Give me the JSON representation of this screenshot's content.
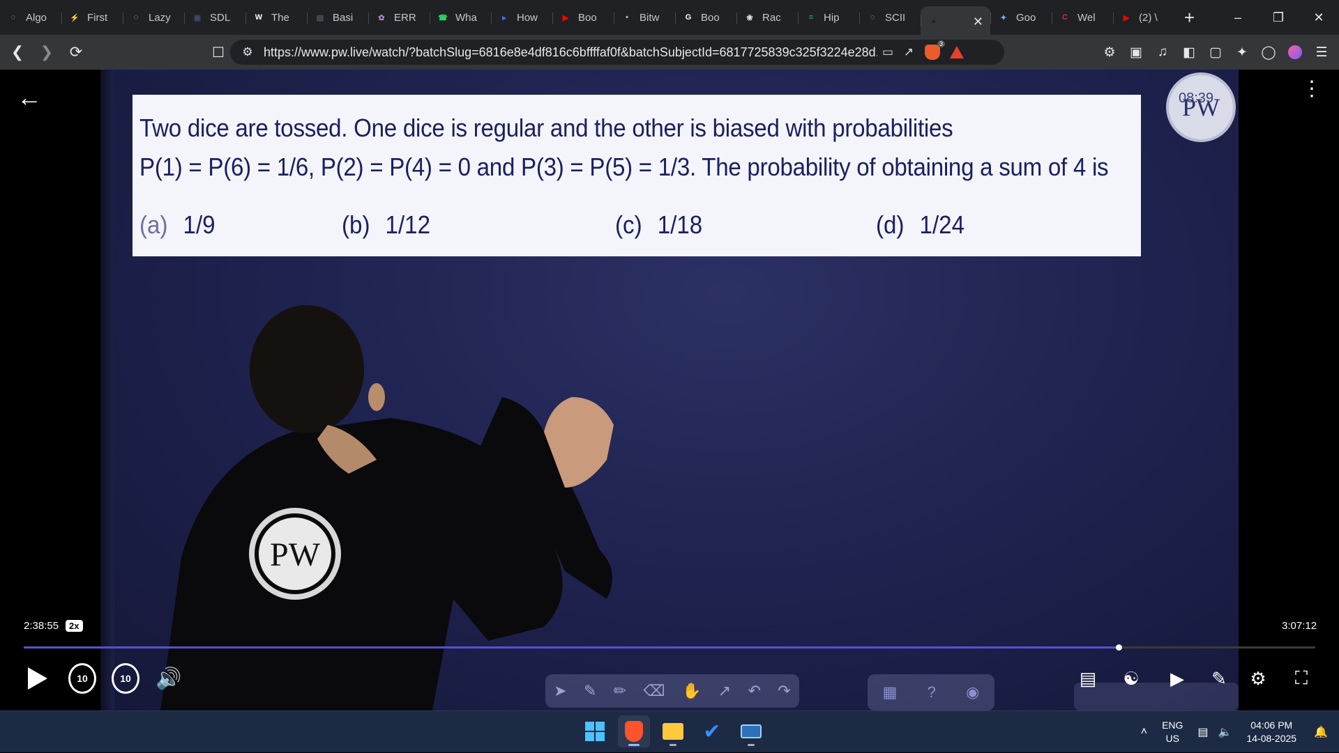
{
  "browser": {
    "tabs": [
      {
        "label": "Algo",
        "icon": "globe-icon",
        "color": "#8fb3c9"
      },
      {
        "label": "First",
        "icon": "bolt-icon",
        "color": "#f0b429"
      },
      {
        "label": "Lazy",
        "icon": "globe-icon",
        "color": "#bdbdbd"
      },
      {
        "label": "SDL",
        "icon": "dark-site-icon",
        "color": "#3b4a6b"
      },
      {
        "label": "The",
        "icon": "w3schools-icon",
        "color": "#ffffff"
      },
      {
        "label": "Basi",
        "icon": "grey-site-icon",
        "color": "#555"
      },
      {
        "label": "ERR",
        "icon": "brain-icon",
        "color": "#a98ad0"
      },
      {
        "label": "Wha",
        "icon": "whatsapp-icon",
        "color": "#25d366"
      },
      {
        "label": "How",
        "icon": "bookmark-icon",
        "color": "#4a6fe3"
      },
      {
        "label": "Boo",
        "icon": "youtube-icon",
        "color": "#ff0000"
      },
      {
        "label": "Bitw",
        "icon": "bitwise-icon",
        "color": "#bdbdbd"
      },
      {
        "label": "Boo",
        "icon": "google-icon",
        "color": "#ffffff"
      },
      {
        "label": "Rac",
        "icon": "openai-icon",
        "color": "#e6e6e6"
      },
      {
        "label": "Hip",
        "icon": "spotify-icon",
        "color": "#1db954"
      },
      {
        "label": "SCII",
        "icon": "globe-icon",
        "color": "#bdbdbd"
      },
      {
        "label": "",
        "icon": "pw-tab-icon",
        "color": "#222"
      },
      {
        "label": "Goo",
        "icon": "gemini-icon",
        "color": "#7aa9ff"
      },
      {
        "label": "Wel",
        "icon": "red-c-icon",
        "color": "#e0283a"
      },
      {
        "label": "(2) \\",
        "icon": "youtube-icon",
        "color": "#ff0000"
      }
    ],
    "active_tab_index": 15,
    "url": "https://www.pw.live/watch/?batchSlug=6816e8e4df816c6bffffaf0f&batchSubjectId=6817725839c325f3224e28d...",
    "brave_shield_count": "3"
  },
  "video": {
    "question": {
      "line1": "Two dice are tossed. One dice is regular and the other is biased with probabilities",
      "line2": "P(1) = P(6) = 1/6, P(2) = P(4) = 0 and P(3) = P(5) = 1/3. The probability of obtaining a sum of 4 is",
      "options": [
        {
          "label": "(a)",
          "value": "1/9"
        },
        {
          "label": "(b)",
          "value": "1/12"
        },
        {
          "label": "(c)",
          "value": "1/18"
        },
        {
          "label": "(d)",
          "value": "1/24"
        }
      ]
    },
    "watermark_text": "PW",
    "watermark_num": "08:39",
    "shirt_logo": "PW",
    "current_time": "2:38:55",
    "speed": "2x",
    "duration": "3:07:12",
    "progress_fraction": 0.848,
    "skip_back": "10",
    "skip_forward": "10"
  },
  "taskbar": {
    "lang_line1": "ENG",
    "lang_line2": "US",
    "time": "04:06 PM",
    "date": "14-08-2025"
  }
}
